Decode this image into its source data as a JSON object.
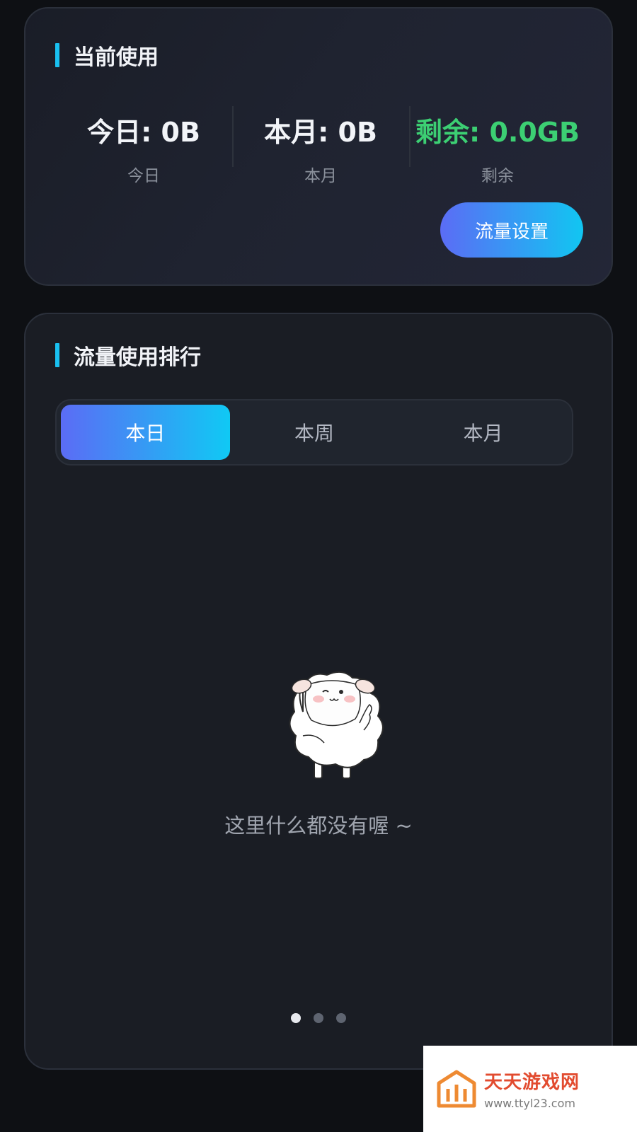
{
  "usage_card": {
    "title": "当前使用",
    "stats": [
      {
        "value": "今日: 0B",
        "label": "今日"
      },
      {
        "value": "本月: 0B",
        "label": "本月"
      },
      {
        "value": "剩余: 0.0GB",
        "label": "剩余"
      }
    ],
    "settings_button": "流量设置"
  },
  "ranking_card": {
    "title": "流量使用排行",
    "tabs": [
      {
        "label": "本日",
        "active": true
      },
      {
        "label": "本周",
        "active": false
      },
      {
        "label": "本月",
        "active": false
      }
    ],
    "empty_state": {
      "image": "sheep-illustration",
      "text": "这里什么都没有喔 ~"
    },
    "pagination": {
      "total": 3,
      "current": 1
    }
  },
  "watermark": {
    "name": "天天游戏网",
    "url": "www.ttyl23.com"
  },
  "colors": {
    "accent": "#19c0f0",
    "gradient_start": "#5b6cf5",
    "gradient_end": "#11c6f2",
    "remaining_green": "#3ccf73",
    "background": "#0e1014"
  }
}
